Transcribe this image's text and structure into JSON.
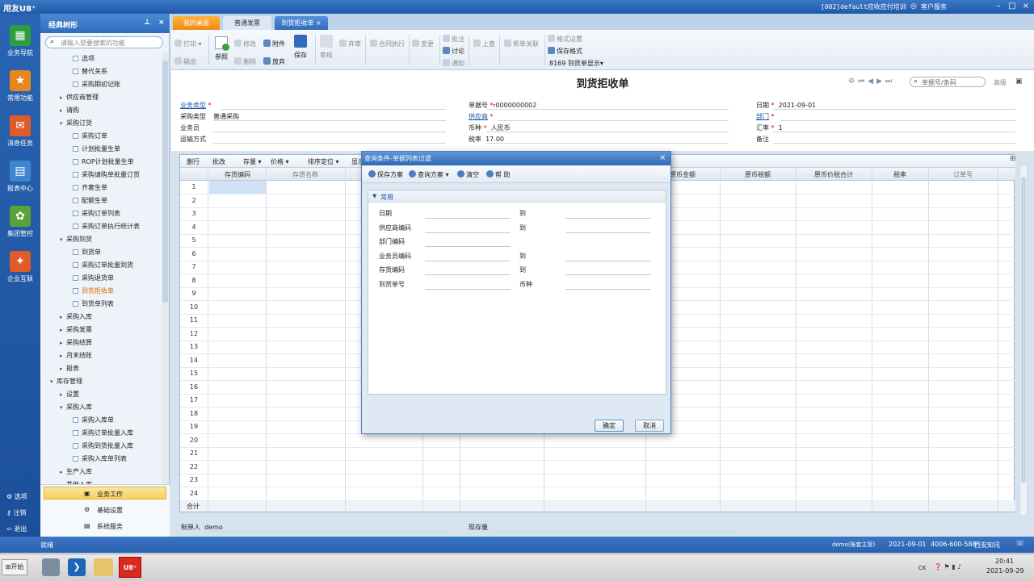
{
  "app": {
    "logo": "用友U8⁺",
    "account": "[002]default应收应付培训",
    "service_label": "客户服务",
    "search_placeholder": "单据条码搜索"
  },
  "leftnav": [
    {
      "label": "业务导航",
      "icon": "grid-icon",
      "color": "#2e9d3e"
    },
    {
      "label": "常用功能",
      "icon": "star-icon",
      "color": "#e8861f"
    },
    {
      "label": "消息任务",
      "icon": "message-icon",
      "color": "#e05a2a"
    },
    {
      "label": "报表中心",
      "icon": "report-icon",
      "color": "#3f86d0"
    },
    {
      "label": "集团管控",
      "icon": "group-icon",
      "color": "#5aa23a"
    },
    {
      "label": "企业互联",
      "icon": "connect-icon",
      "color": "#e05a2a"
    }
  ],
  "leftnav_bottom": [
    "选项",
    "注销",
    "退出"
  ],
  "tree": {
    "title": "经典树形",
    "search_placeholder": "请输入您要搜索的功能",
    "nodes": [
      {
        "label": "选项",
        "indent": 3,
        "type": "leaf"
      },
      {
        "label": "替代关系",
        "indent": 3,
        "type": "leaf"
      },
      {
        "label": "采购期初记账",
        "indent": 3,
        "type": "leaf"
      },
      {
        "label": "供应商管理",
        "indent": 2,
        "type": "collapsed"
      },
      {
        "label": "请购",
        "indent": 2,
        "type": "collapsed"
      },
      {
        "label": "采购订货",
        "indent": 2,
        "type": "expanded"
      },
      {
        "label": "采购订单",
        "indent": 3,
        "type": "leaf"
      },
      {
        "label": "计划批量生单",
        "indent": 3,
        "type": "leaf"
      },
      {
        "label": "ROP计划批量生单",
        "indent": 3,
        "type": "leaf"
      },
      {
        "label": "采购请购单批量订货",
        "indent": 3,
        "type": "leaf"
      },
      {
        "label": "齐套生单",
        "indent": 3,
        "type": "leaf"
      },
      {
        "label": "配额生单",
        "indent": 3,
        "type": "leaf"
      },
      {
        "label": "采购订单列表",
        "indent": 3,
        "type": "leaf"
      },
      {
        "label": "采购订单执行统计表",
        "indent": 3,
        "type": "leaf"
      },
      {
        "label": "采购到货",
        "indent": 2,
        "type": "expanded"
      },
      {
        "label": "到货单",
        "indent": 3,
        "type": "leaf"
      },
      {
        "label": "采购订单批量到货",
        "indent": 3,
        "type": "leaf"
      },
      {
        "label": "采购退货单",
        "indent": 3,
        "type": "leaf"
      },
      {
        "label": "到货拒收单",
        "indent": 3,
        "type": "leaf",
        "selected": true
      },
      {
        "label": "到货单列表",
        "indent": 3,
        "type": "leaf"
      },
      {
        "label": "采购入库",
        "indent": 2,
        "type": "collapsed"
      },
      {
        "label": "采购发票",
        "indent": 2,
        "type": "collapsed"
      },
      {
        "label": "采购结算",
        "indent": 2,
        "type": "collapsed"
      },
      {
        "label": "月末结账",
        "indent": 2,
        "type": "collapsed"
      },
      {
        "label": "报表",
        "indent": 2,
        "type": "collapsed"
      },
      {
        "label": "库存管理",
        "indent": 1,
        "type": "expanded"
      },
      {
        "label": "设置",
        "indent": 2,
        "type": "collapsed"
      },
      {
        "label": "采购入库",
        "indent": 2,
        "type": "expanded"
      },
      {
        "label": "采购入库单",
        "indent": 3,
        "type": "leaf"
      },
      {
        "label": "采购订单批量入库",
        "indent": 3,
        "type": "leaf"
      },
      {
        "label": "采购到货批量入库",
        "indent": 3,
        "type": "leaf"
      },
      {
        "label": "采购入库单列表",
        "indent": 3,
        "type": "leaf"
      },
      {
        "label": "生产入库",
        "indent": 2,
        "type": "collapsed"
      },
      {
        "label": "其他入库",
        "indent": 2,
        "type": "collapsed"
      }
    ],
    "footer": [
      {
        "label": "业务工作",
        "icon": "briefcase-icon",
        "selected": true
      },
      {
        "label": "基础设置",
        "icon": "gear-icon"
      },
      {
        "label": "系统服务",
        "icon": "service-icon"
      }
    ]
  },
  "tabs": [
    {
      "label": "我的桌面",
      "state": "orange"
    },
    {
      "label": "普通发票",
      "state": "normal"
    },
    {
      "label": "到货拒收单",
      "state": "active"
    }
  ],
  "toolbar": {
    "print": "打印",
    "export": "输出",
    "copy": "参照",
    "modify": "修改",
    "delete": "删除",
    "attach": "附件",
    "abandon": "放弃",
    "save": "保存",
    "audit": "审核",
    "reaudit": "弃审",
    "contract": "合同执行",
    "change": "变更",
    "approve_note": "批注",
    "discuss": "讨论",
    "notify": "通知",
    "query": "上查",
    "help_link": "帮单关联",
    "format_setting": "格式设置",
    "save_format": "保存格式",
    "template": "8169 到货单显示"
  },
  "form": {
    "title": "到货拒收单",
    "nav_placeholder": "单据号/条码",
    "advanced": "高级",
    "fields": {
      "biz_type": {
        "label": "业务类型",
        "value": ""
      },
      "purchase_type": {
        "label": "采购类型",
        "value": "普通采购"
      },
      "salesman": {
        "label": "业务员",
        "value": ""
      },
      "transport": {
        "label": "运输方式",
        "value": ""
      },
      "doc_no": {
        "label": "单据号",
        "value": "0000000002"
      },
      "supplier": {
        "label": "供应商",
        "value": ""
      },
      "currency": {
        "label": "币种",
        "value": "人民币"
      },
      "tax_rate": {
        "label": "税率",
        "value": "17.00"
      },
      "date": {
        "label": "日期",
        "value": "2021-09-01"
      },
      "dept": {
        "label": "部门",
        "value": ""
      },
      "rate": {
        "label": "汇率",
        "value": "1"
      },
      "remark": {
        "label": "备注",
        "value": ""
      }
    }
  },
  "grid": {
    "toolbar": [
      "删行",
      "批改",
      "存量",
      "价格",
      "排序定位",
      "显示"
    ],
    "columns": [
      "存货编码",
      "存货名称",
      "原币金额",
      "原币税额",
      "原币价税合计",
      "税率",
      "订单号"
    ],
    "rows": 24,
    "total_label": "合计"
  },
  "bottom_form": {
    "maker_label": "制单人",
    "maker_value": "demo",
    "stock_label": "现存量"
  },
  "dialog": {
    "title": "查询条件-单据列表过滤",
    "toolbar": {
      "save_scheme": "保存方案",
      "query_scheme": "查询方案",
      "clear": "清空",
      "help": "帮 助"
    },
    "section": "常用",
    "rows": [
      {
        "label": "日期",
        "to": "到"
      },
      {
        "label": "供应商编码",
        "to": "到"
      },
      {
        "label": "部门编码",
        "to": ""
      },
      {
        "label": "业务员编码",
        "to": "到"
      },
      {
        "label": "存货编码",
        "to": "到"
      },
      {
        "label": "到货单号",
        "to": "币种"
      }
    ],
    "ok": "确定",
    "cancel": "取消"
  },
  "status": {
    "text": "就绪",
    "user": "demo(账套主管)",
    "date": "2021-09-01",
    "hotline": "4006-600-588",
    "company": "西安知讯"
  },
  "taskbar": {
    "start": "开始",
    "lang": "CK",
    "time": "20:41",
    "date": "2021-09-29"
  }
}
